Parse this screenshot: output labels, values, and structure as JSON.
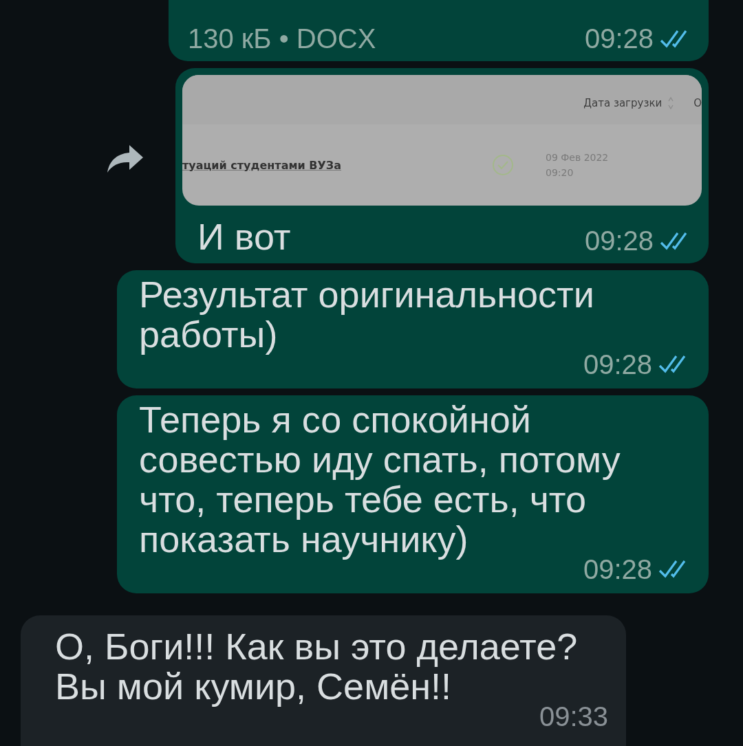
{
  "messages": [
    {
      "kind": "document",
      "outgoing": true,
      "details": "130 кБ • DOCX",
      "time": "09:28",
      "read": true
    },
    {
      "kind": "image",
      "outgoing": true,
      "forwardable": true,
      "screenshot": {
        "column_header": "Дата загрузки",
        "column_cut": "О",
        "file_name": "туаций студентами ВУЗа",
        "checked": true,
        "date": "09 Фев 2022",
        "time": "09:20"
      },
      "caption": "И вот",
      "time": "09:28",
      "read": true
    },
    {
      "kind": "text",
      "outgoing": true,
      "text": "Результат оригинальности работы)",
      "time": "09:28",
      "read": true
    },
    {
      "kind": "text",
      "outgoing": true,
      "text": "Теперь я со спокойной совестью иду спать, потому что, теперь тебе есть, что показать научнику)",
      "time": "09:28",
      "read": true
    },
    {
      "kind": "text",
      "outgoing": false,
      "text": "О, Боги!!! Как вы это делаете? Вы мой кумир, Семён!!",
      "time": "09:33"
    }
  ]
}
